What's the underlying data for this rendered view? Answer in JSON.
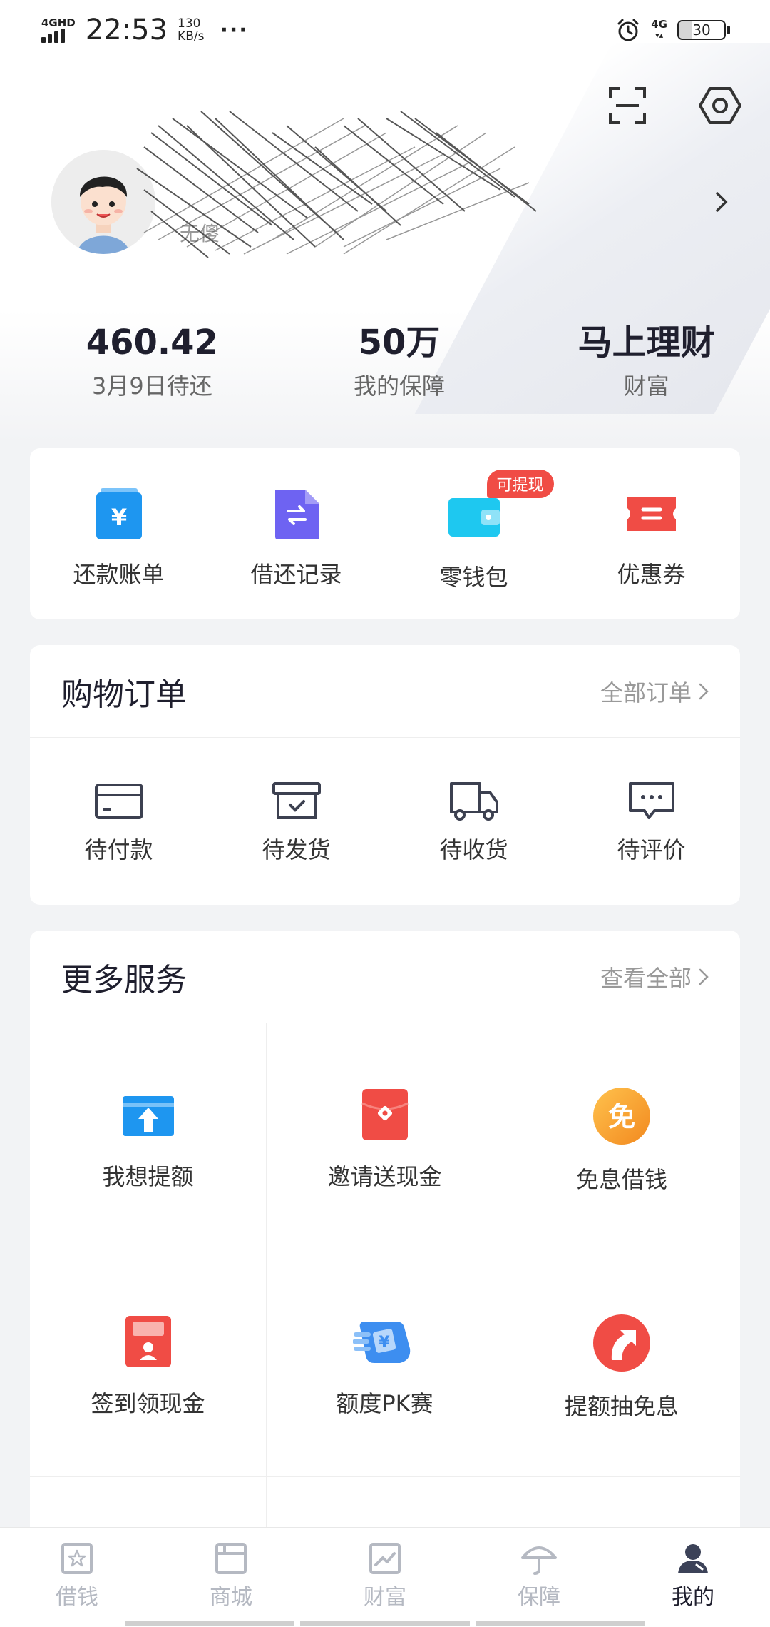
{
  "status_bar": {
    "network": "4GHD",
    "time": "22:53",
    "speed_value": "130",
    "speed_unit": "KB/s",
    "more": "···",
    "network_right": "4G",
    "battery": "30",
    "battery_level": 0.3
  },
  "profile": {
    "username": "无傻"
  },
  "stats": [
    {
      "value": "460.42",
      "label": "3月9日待还"
    },
    {
      "value": "50万",
      "label": "我的保障"
    },
    {
      "value": "马上理财",
      "label": "财富"
    }
  ],
  "quick_actions": [
    {
      "label": "还款账单",
      "icon": "bill-icon"
    },
    {
      "label": "借还记录",
      "icon": "record-icon"
    },
    {
      "label": "零钱包",
      "icon": "wallet-icon",
      "badge": "可提现"
    },
    {
      "label": "优惠券",
      "icon": "coupon-icon"
    }
  ],
  "orders": {
    "title": "购物订单",
    "link": "全部订单",
    "items": [
      {
        "label": "待付款",
        "icon": "card-icon"
      },
      {
        "label": "待发货",
        "icon": "box-icon"
      },
      {
        "label": "待收货",
        "icon": "truck-icon"
      },
      {
        "label": "待评价",
        "icon": "comment-icon"
      }
    ]
  },
  "services": {
    "title": "更多服务",
    "link": "查看全部",
    "items": [
      {
        "label": "我想提额",
        "icon": "raise-limit-icon"
      },
      {
        "label": "邀请送现金",
        "icon": "red-envelope-icon"
      },
      {
        "label": "免息借钱",
        "icon": "free-interest-icon",
        "glyph": "免"
      },
      {
        "label": "签到领现金",
        "icon": "checkin-icon"
      },
      {
        "label": "额度PK赛",
        "icon": "pk-icon"
      },
      {
        "label": "提额抽免息",
        "icon": "raise-draw-icon"
      }
    ]
  },
  "bottom_nav": [
    {
      "label": "借钱",
      "icon": "borrow-icon"
    },
    {
      "label": "商城",
      "icon": "mall-icon"
    },
    {
      "label": "财富",
      "icon": "wealth-icon"
    },
    {
      "label": "保障",
      "icon": "umbrella-icon"
    },
    {
      "label": "我的",
      "icon": "user-icon",
      "active": true
    }
  ],
  "colors": {
    "accent_blue": "#1e96f0",
    "purple": "#6e63f2",
    "cyan": "#1ec8f0",
    "red": "#f04c45",
    "orange": "#f7a531",
    "dark_text": "#1f1f2e",
    "inactive_nav": "#b5b9c2"
  }
}
